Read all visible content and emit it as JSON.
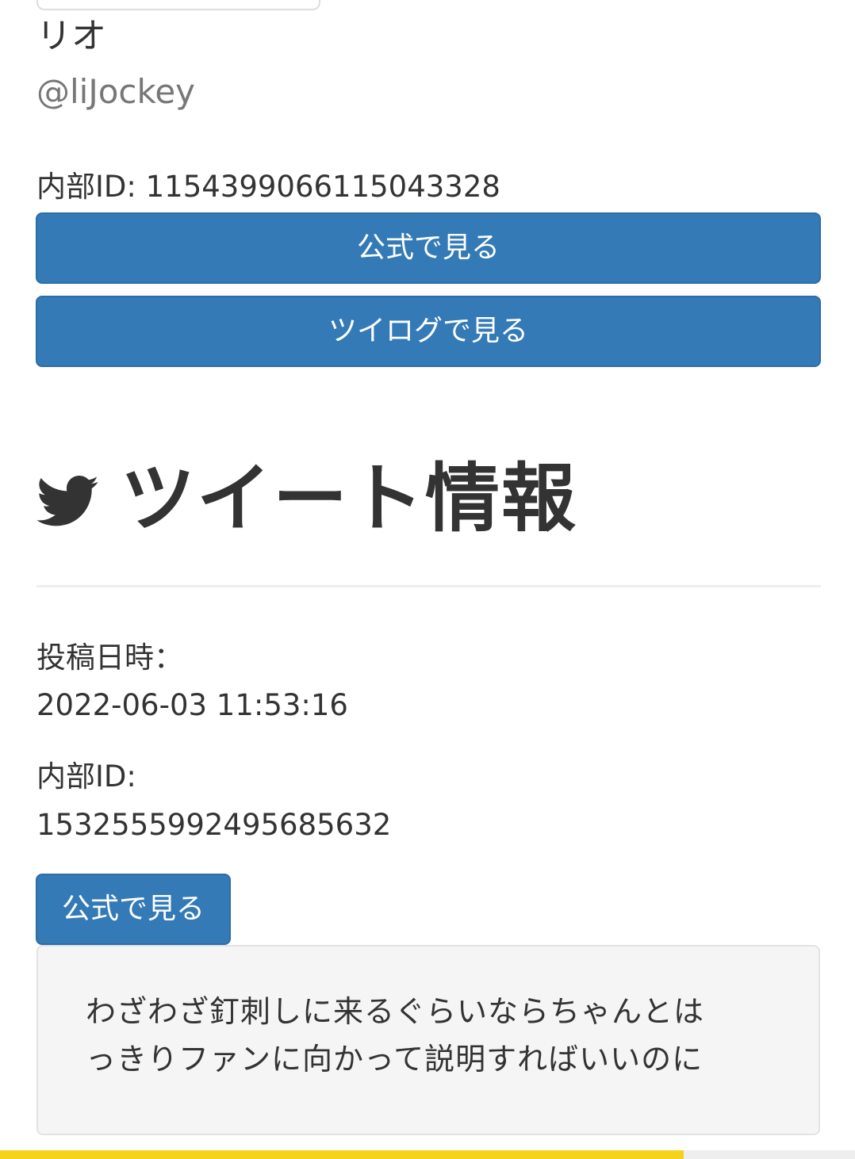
{
  "user": {
    "name": "リオ",
    "handle": "@liJockey",
    "internal_id_line": "内部ID: 1154399066115043328",
    "view_official_label": "公式で見る",
    "view_twilog_label": "ツイログで見る"
  },
  "tweet_section": {
    "icon": "twitter-bird-icon",
    "title": "ツイート情報",
    "posted_label": "投稿日時：",
    "posted_value": "2022-06-03 11:53:16",
    "internal_id_label": "内部ID:",
    "internal_id_value": "1532555992495685632",
    "view_official_label": "公式で見る",
    "text_line1": "わざわざ釘刺しに来るぐらいならちゃんとは",
    "text_line2": "っきりファンに向かって説明すればいいのに"
  },
  "page_progress": 0.8,
  "colors": {
    "button_blue": "#337ab7",
    "progress_yellow": "#f5d31c"
  }
}
